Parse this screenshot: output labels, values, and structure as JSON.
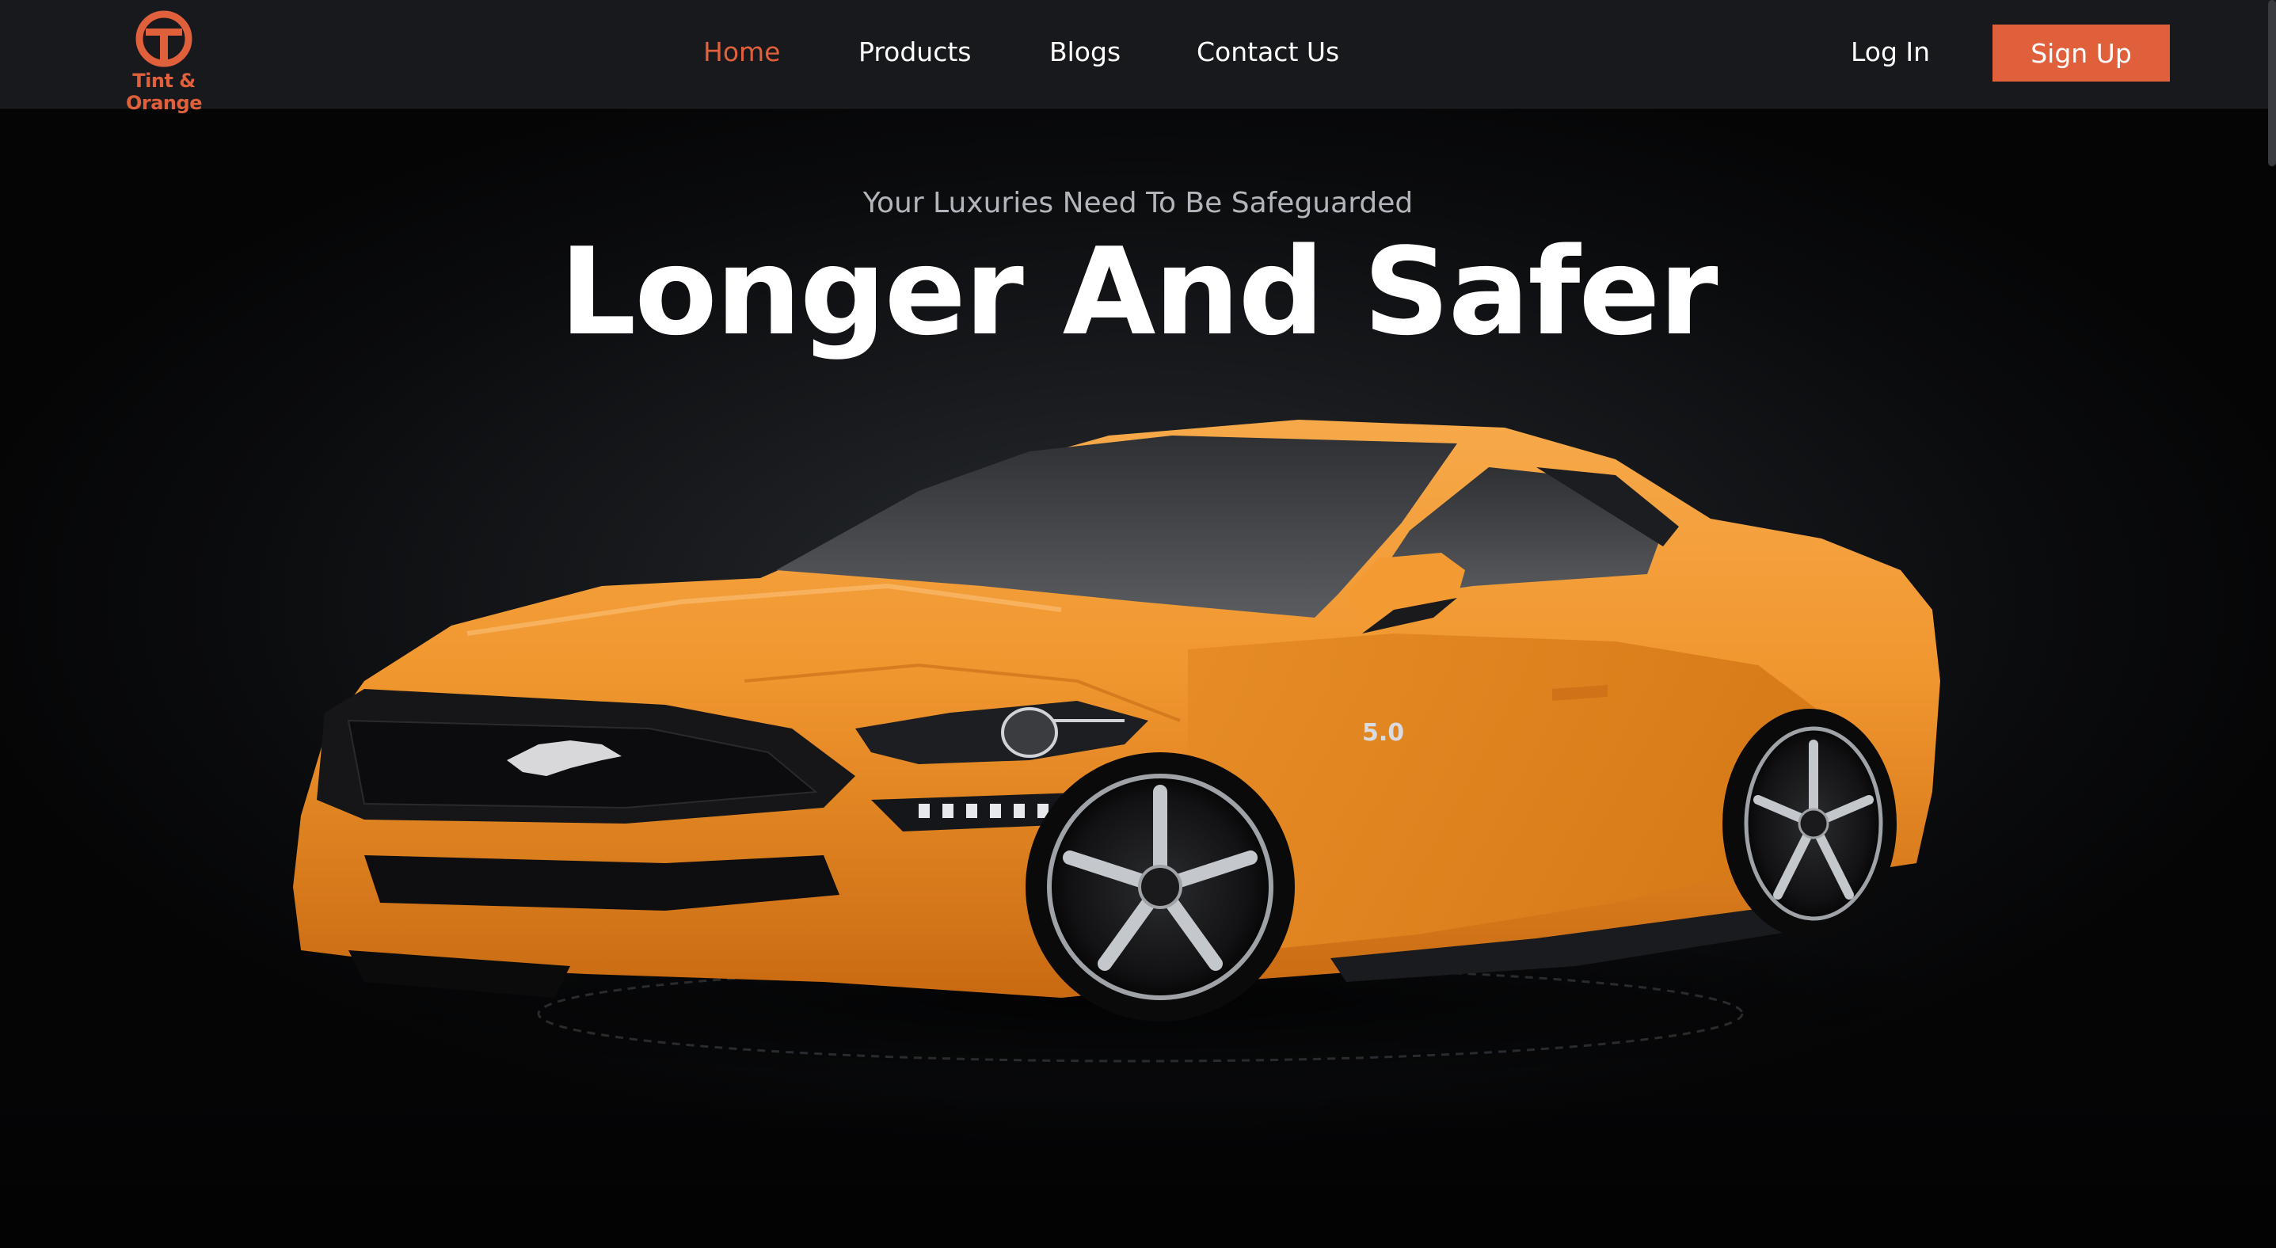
{
  "brand": {
    "name": "Tint & Orange",
    "accent_color": "#e0603c",
    "logo_icon": "t-circle-logo-icon"
  },
  "nav": {
    "items": [
      {
        "label": "Home",
        "active": true
      },
      {
        "label": "Products",
        "active": false
      },
      {
        "label": "Blogs",
        "active": false
      },
      {
        "label": "Contact Us",
        "active": false
      }
    ],
    "login_label": "Log In",
    "signup_label": "Sign Up"
  },
  "hero": {
    "subtitle": "Your Luxuries Need To Be Safeguarded",
    "headline": "Longer And Safer",
    "image": "orange-sports-car",
    "car_badge": "5.0",
    "car_color": "#f0962e"
  }
}
